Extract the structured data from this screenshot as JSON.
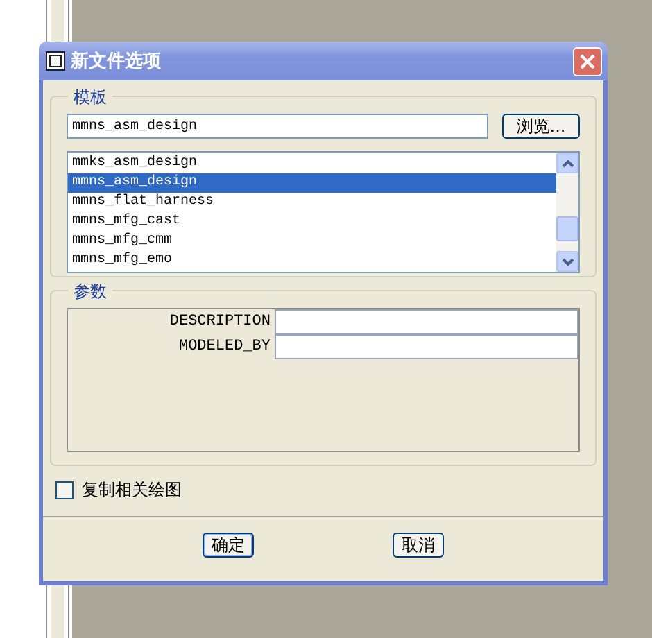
{
  "window": {
    "title": "新文件选项"
  },
  "template": {
    "label": "模板",
    "value": "mmns_asm_design",
    "browse": "浏览...",
    "items": [
      {
        "label": "mmks_asm_design",
        "selected": false
      },
      {
        "label": "mmns_asm_design",
        "selected": true
      },
      {
        "label": "mmns_flat_harness",
        "selected": false
      },
      {
        "label": "mmns_mfg_cast",
        "selected": false
      },
      {
        "label": "mmns_mfg_cmm",
        "selected": false
      },
      {
        "label": "mmns_mfg_emo",
        "selected": false
      }
    ]
  },
  "parameters": {
    "label": "参数",
    "rows": [
      {
        "name": "DESCRIPTION"
      },
      {
        "name": "MODELED_BY"
      }
    ]
  },
  "copy_drawings": {
    "label": "复制相关绘图",
    "checked": false
  },
  "buttons": [
    {
      "label": "确定",
      "kind": "default"
    },
    {
      "label": "取消",
      "kind": "normal"
    }
  ]
}
